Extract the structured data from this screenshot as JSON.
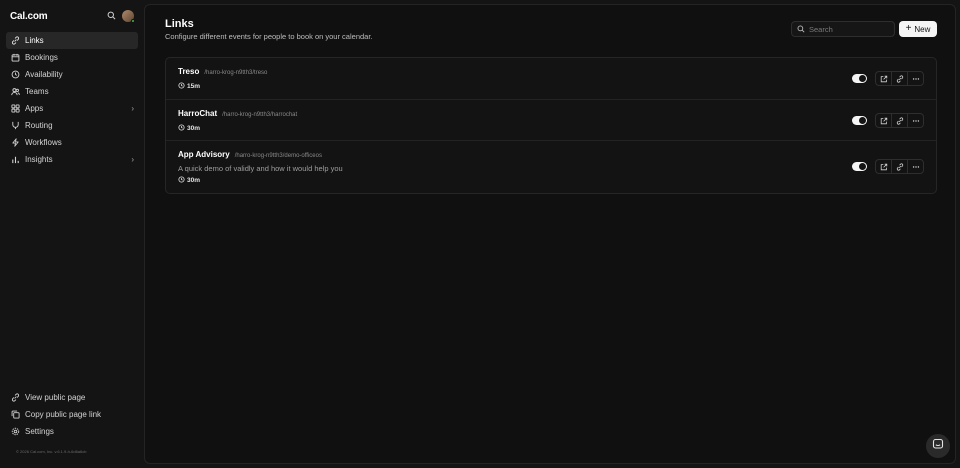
{
  "brand": {
    "logo": "Cal.com"
  },
  "sidebar": {
    "items": [
      {
        "label": "Links",
        "icon": "link-icon",
        "active": true
      },
      {
        "label": "Bookings",
        "icon": "calendar-icon"
      },
      {
        "label": "Availability",
        "icon": "clock-icon"
      },
      {
        "label": "Teams",
        "icon": "users-icon"
      },
      {
        "label": "Apps",
        "icon": "grid-icon",
        "chevron": true
      },
      {
        "label": "Routing",
        "icon": "split-icon"
      },
      {
        "label": "Workflows",
        "icon": "zap-icon"
      },
      {
        "label": "Insights",
        "icon": "chart-icon",
        "chevron": true
      }
    ],
    "bottom": [
      {
        "label": "View public page",
        "icon": "external-link-icon"
      },
      {
        "label": "Copy public page link",
        "icon": "copy-link-icon"
      },
      {
        "label": "Settings",
        "icon": "gear-icon"
      }
    ],
    "footer": "© 2026 Cal.com, Inc. v.6.1.9-h-6d6a6cb"
  },
  "page": {
    "title": "Links",
    "subtitle": "Configure different events for people to book on your calendar."
  },
  "search": {
    "placeholder": "Search"
  },
  "new_button": {
    "label": "New"
  },
  "events": [
    {
      "name": "Treso",
      "slug": "/harro-krog-n9tth3/treso",
      "description": "",
      "duration": "15m",
      "enabled": true
    },
    {
      "name": "HarroChat",
      "slug": "/harro-krog-n9tth3/harrochat",
      "description": "",
      "duration": "30m",
      "enabled": true
    },
    {
      "name": "App Advisory",
      "slug": "/harro-krog-n9tth3/demo-officeos",
      "description": "A quick demo of validly and how it would help you",
      "duration": "30m",
      "enabled": true
    }
  ],
  "colors": {
    "background": "#141414",
    "surface": "#101010",
    "accent": "#f5f5f5",
    "online": "#3fb950"
  }
}
